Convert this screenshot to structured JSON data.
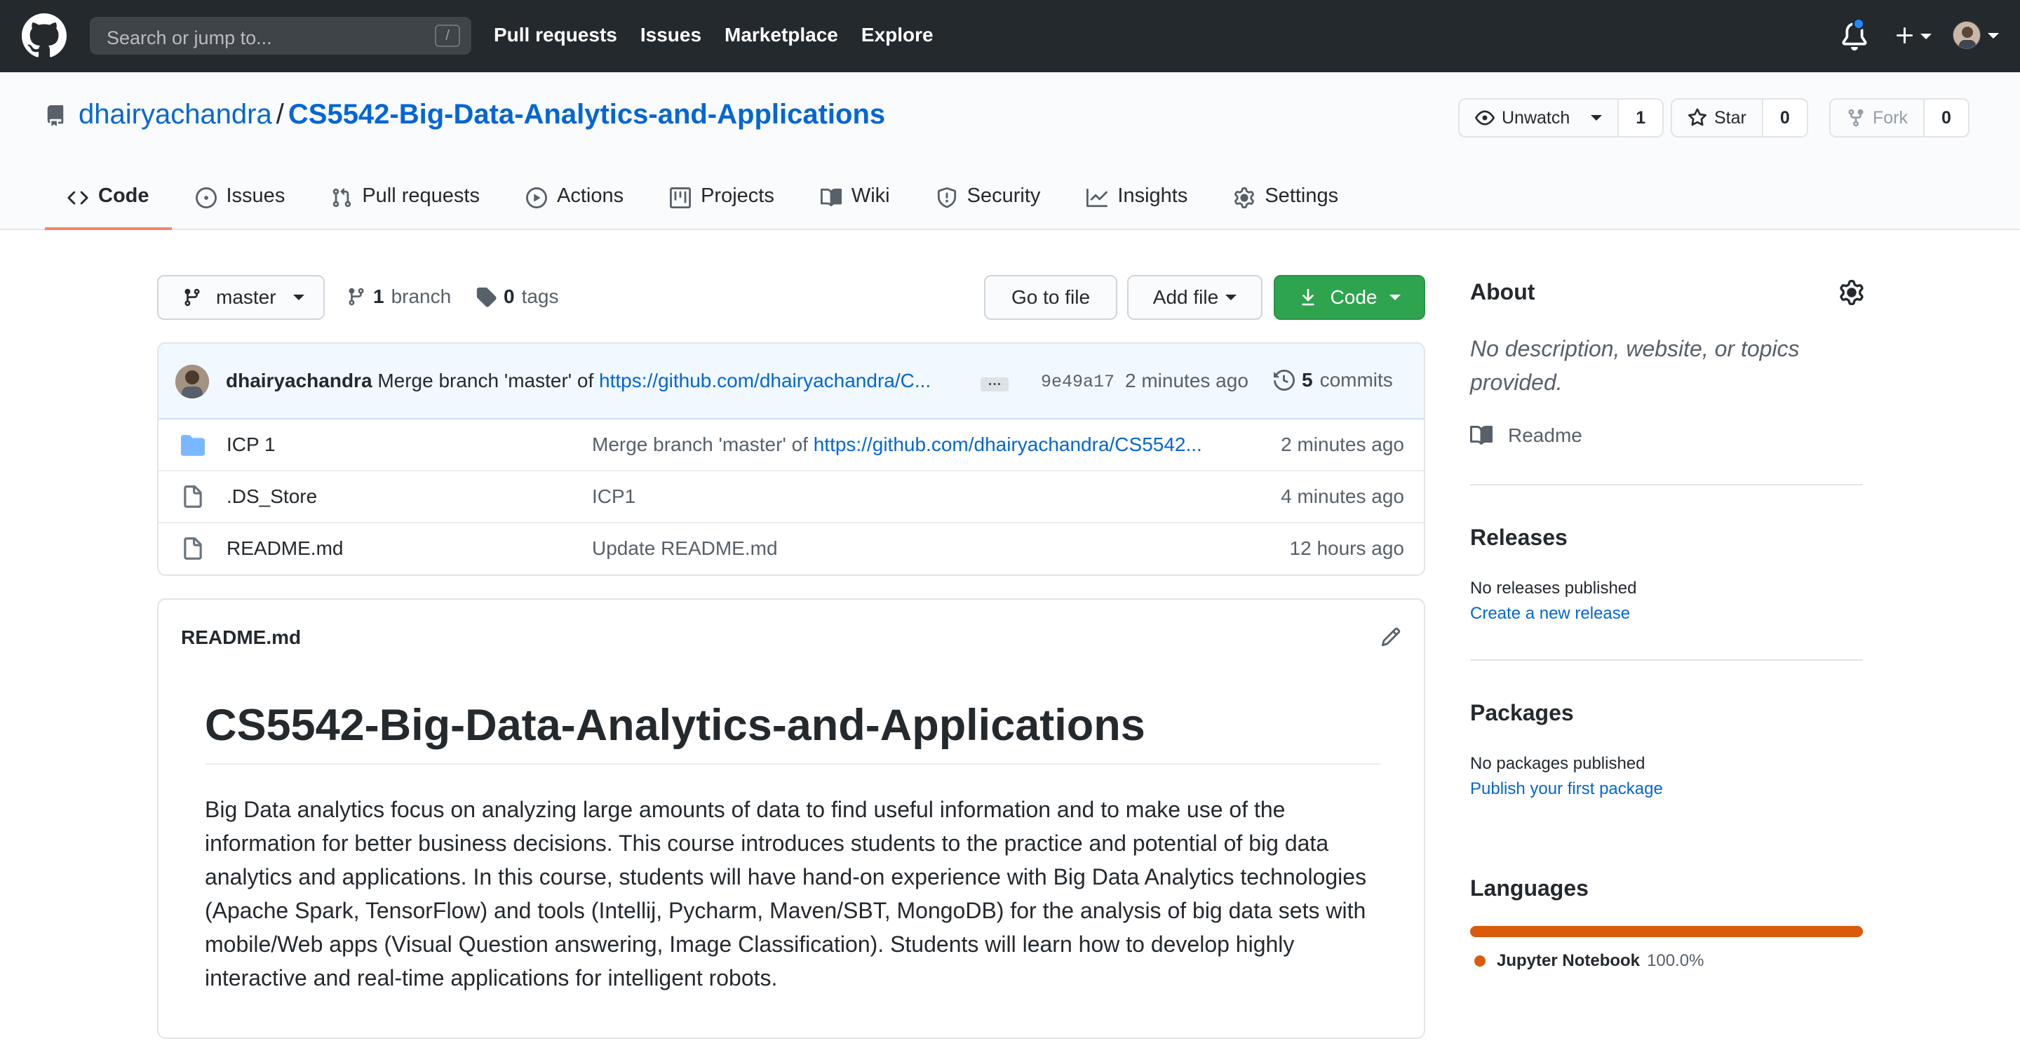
{
  "header": {
    "search_placeholder": "Search or jump to...",
    "search_key": "/",
    "nav": [
      "Pull requests",
      "Issues",
      "Marketplace",
      "Explore"
    ]
  },
  "repo": {
    "owner": "dhairyachandra",
    "separator": "/",
    "name": "CS5542-Big-Data-Analytics-and-Applications",
    "watch_label": "Unwatch",
    "watch_count": "1",
    "star_label": "Star",
    "star_count": "0",
    "fork_label": "Fork",
    "fork_count": "0"
  },
  "tabs": [
    {
      "label": "Code",
      "icon": "code-icon"
    },
    {
      "label": "Issues",
      "icon": "issue-icon"
    },
    {
      "label": "Pull requests",
      "icon": "pull-request-icon"
    },
    {
      "label": "Actions",
      "icon": "play-icon"
    },
    {
      "label": "Projects",
      "icon": "project-icon"
    },
    {
      "label": "Wiki",
      "icon": "book-icon"
    },
    {
      "label": "Security",
      "icon": "shield-icon"
    },
    {
      "label": "Insights",
      "icon": "graph-icon"
    },
    {
      "label": "Settings",
      "icon": "gear-icon"
    }
  ],
  "toolbar": {
    "branch": "master",
    "branch_count": "1",
    "branch_word": "branch",
    "tag_count": "0",
    "tag_word": "tags",
    "go_to_file": "Go to file",
    "add_file": "Add file",
    "code": "Code"
  },
  "latest_commit": {
    "author": "dhairyachandra",
    "message": "Merge branch 'master' of",
    "link": "https://github.com/dhairyachandra/C...",
    "ellipsis": "…",
    "sha": "9e49a17",
    "time": "2 minutes ago",
    "commit_count": "5",
    "commit_word": "commits"
  },
  "files": [
    {
      "name": "ICP 1",
      "type": "folder",
      "message": "Merge branch 'master' of ",
      "message_link": "https://github.com/dhairyachandra/CS5542...",
      "age": "2 minutes ago"
    },
    {
      "name": ".DS_Store",
      "type": "file",
      "message": "ICP1",
      "message_link": "",
      "age": "4 minutes ago"
    },
    {
      "name": "README.md",
      "type": "file",
      "message": "Update README.md",
      "message_link": "",
      "age": "12 hours ago"
    }
  ],
  "readme": {
    "filename": "README.md",
    "title": "CS5542-Big-Data-Analytics-and-Applications",
    "body": "Big Data analytics focus on analyzing large amounts of data to find useful information and to make use of the information for better business decisions. This course introduces students to the practice and potential of big data analytics and applications. In this course, students will have hand-on experience with Big Data Analytics technologies (Apache Spark, TensorFlow) and tools (Intellij, Pycharm, Maven/SBT, MongoDB) for the analysis of big data sets with mobile/Web apps (Visual Question answering, Image Classification). Students will learn how to develop highly interactive and real-time applications for intelligent robots."
  },
  "sidebar": {
    "about_title": "About",
    "about_desc": "No description, website, or topics provided.",
    "readme_link": "Readme",
    "releases_title": "Releases",
    "releases_text": "No releases published",
    "releases_link": "Create a new release",
    "packages_title": "Packages",
    "packages_text": "No packages published",
    "packages_link": "Publish your first package",
    "languages_title": "Languages",
    "language_name": "Jupyter Notebook",
    "language_percent": "100.0%",
    "language_color": "#da5b0b"
  }
}
